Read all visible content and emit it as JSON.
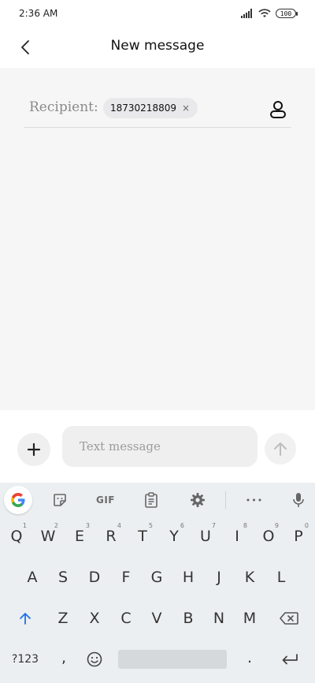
{
  "status_bar": {
    "time": "2:36 AM",
    "battery": "100"
  },
  "header": {
    "title": "New message"
  },
  "recipient": {
    "label": "Recipient:",
    "chip": "18730218809",
    "chip_remove": "×"
  },
  "composer": {
    "placeholder": "Text message"
  },
  "keyboard": {
    "toolbar": {
      "gif": "GIF",
      "more": "•••"
    },
    "row1": [
      {
        "key": "Q",
        "hint": "1"
      },
      {
        "key": "W",
        "hint": "2"
      },
      {
        "key": "E",
        "hint": "3"
      },
      {
        "key": "R",
        "hint": "4"
      },
      {
        "key": "T",
        "hint": "5"
      },
      {
        "key": "Y",
        "hint": "6"
      },
      {
        "key": "U",
        "hint": "7"
      },
      {
        "key": "I",
        "hint": "8"
      },
      {
        "key": "O",
        "hint": "9"
      },
      {
        "key": "P",
        "hint": "0"
      }
    ],
    "row2": [
      "A",
      "S",
      "D",
      "F",
      "G",
      "H",
      "J",
      "K",
      "L"
    ],
    "row3": [
      "Z",
      "X",
      "C",
      "V",
      "B",
      "N",
      "M"
    ],
    "symbols_key": "?123",
    "comma_key": ",",
    "period_key": "."
  },
  "colors": {
    "accent": "#1a73e8",
    "keyboard_bg": "#eceff1"
  }
}
